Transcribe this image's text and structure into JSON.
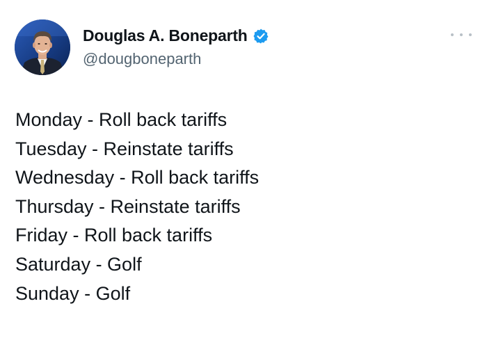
{
  "author": {
    "display_name": "Douglas A. Boneparth",
    "handle": "@dougboneparth",
    "verified": true,
    "verified_icon": "verified-badge-icon",
    "verified_color": "#1d9bf0"
  },
  "more_menu_icon": "more-options-icon",
  "tweet": {
    "lines": [
      "Monday - Roll back tariffs",
      "Tuesday - Reinstate tariffs",
      "Wednesday - Roll back tariffs",
      "Thursday - Reinstate tariffs",
      "Friday - Roll back tariffs",
      "Saturday - Golf",
      "Sunday - Golf"
    ]
  },
  "colors": {
    "text_primary": "#0f1419",
    "text_secondary": "#536471",
    "background": "#ffffff"
  }
}
